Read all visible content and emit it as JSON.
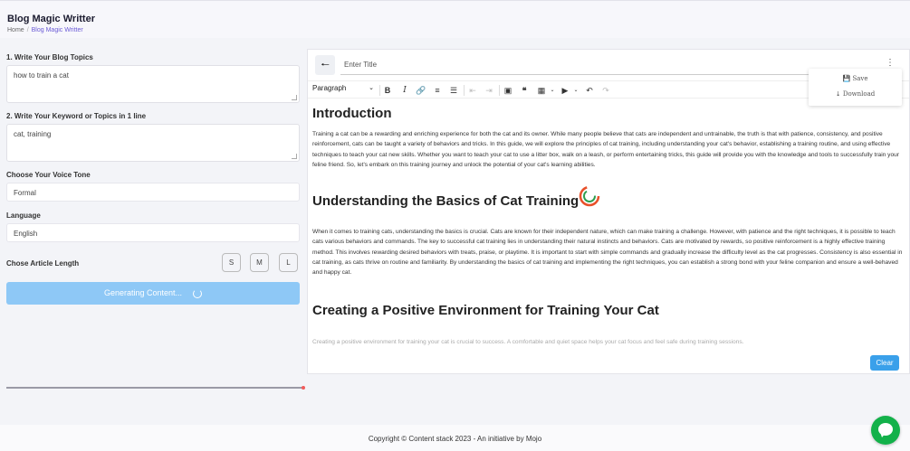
{
  "header": {
    "title": "Blog Magic Writter",
    "breadcrumb": {
      "home": "Home",
      "current": "Blog Magic Writter"
    }
  },
  "form": {
    "topics_label": "1. Write Your Blog Topics",
    "topics_value": "how to train a cat",
    "keywords_label": "2. Write Your Keyword or Topics in 1 line",
    "keywords_value": "cat, training",
    "tone_label": "Choose Your Voice Tone",
    "tone_value": "Formal",
    "language_label": "Language",
    "language_value": "English",
    "length_label": "Chose Article Length",
    "length_options": [
      "S",
      "M",
      "L"
    ],
    "generate_label": "Generating Content...",
    "progress": 1.0
  },
  "editor": {
    "title_placeholder": "Enter Title",
    "paragraph_style": "Paragraph",
    "menu": {
      "save": "Save",
      "download": "Download"
    },
    "clear_label": "Clear",
    "content": {
      "h1": "Introduction",
      "p1": "Training a cat can be a rewarding and enriching experience for both the cat and its owner. While many people believe that cats are independent and untrainable, the truth is that with patience, consistency, and positive reinforcement, cats can be taught a variety of behaviors and tricks. In this guide, we will explore the principles of cat training, including understanding your cat's behavior, establishing a training routine, and using effective techniques to teach your cat new skills. Whether you want to teach your cat to use a litter box, walk on a leash, or perform entertaining tricks, this guide will provide you with the knowledge and tools to successfully train your feline friend. So, let's embark on this training journey and unlock the potential of your cat's learning abilities.",
      "h2": "Understanding the Basics of Cat Training",
      "p2": "When it comes to training cats, understanding the basics is crucial. Cats are known for their independent nature, which can make training a challenge. However, with patience and the right techniques, it is possible to teach cats various behaviors and commands. The key to successful cat training lies in understanding their natural instincts and behaviors. Cats are motivated by rewards, so positive reinforcement is a highly effective training method. This involves rewarding desired behaviors with treats, praise, or playtime. It is important to start with simple commands and gradually increase the difficulty level as the cat progresses. Consistency is also essential in cat training, as cats thrive on routine and familiarity. By understanding the basics of cat training and implementing the right techniques, you can establish a strong bond with your feline companion and ensure a well-behaved and happy cat.",
      "h3": "Creating a Positive Environment for Training Your Cat",
      "p3": "Creating a positive environment for training your cat is crucial to success. A comfortable and quiet space helps your cat focus and feel safe during training sessions."
    }
  },
  "footer": {
    "text": "Copyright © Content stack 2023 - An initiative by Mojo"
  },
  "colors": {
    "accent": "#3aa0ea",
    "generate_button": "#8ec8f6",
    "chat": "#13b14a",
    "brand_purple": "#6b5bd6"
  }
}
